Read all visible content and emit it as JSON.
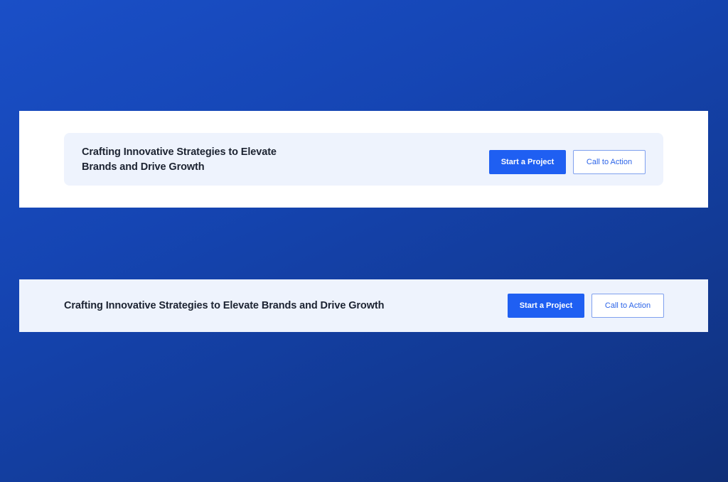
{
  "variant_boxed": {
    "headline": "Crafting Innovative Strategies to Elevate Brands and Drive Growth",
    "primary_label": "Start a Project",
    "secondary_label": "Call to Action"
  },
  "variant_full": {
    "headline": "Crafting Innovative Strategies to Elevate Brands and Drive Growth",
    "primary_label": "Start a Project",
    "secondary_label": "Call to Action"
  },
  "colors": {
    "background_gradient_start": "#1a4fc7",
    "background_gradient_end": "#102f78",
    "card_background": "#eef3fd",
    "primary_button": "#1f5ff2",
    "secondary_button_text": "#2c64e8",
    "headline_text": "#1c2331"
  }
}
